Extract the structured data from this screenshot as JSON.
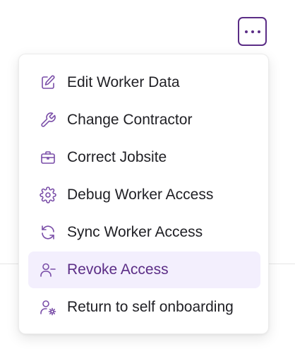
{
  "colors": {
    "accent": "#5b2d86",
    "icon": "#7a4ea8",
    "active_bg": "#f3effd",
    "text": "#1f1f24"
  },
  "more_button": {
    "icon": "ellipsis-icon"
  },
  "menu": {
    "items": [
      {
        "label": "Edit Worker Data",
        "icon": "edit-icon",
        "active": false
      },
      {
        "label": "Change Contractor",
        "icon": "wrench-icon",
        "active": false
      },
      {
        "label": "Correct Jobsite",
        "icon": "briefcase-icon",
        "active": false
      },
      {
        "label": "Debug Worker Access",
        "icon": "gear-icon",
        "active": false
      },
      {
        "label": "Sync Worker Access",
        "icon": "sync-icon",
        "active": false
      },
      {
        "label": "Revoke Access",
        "icon": "user-minus-icon",
        "active": true
      },
      {
        "label": "Return to self onboarding",
        "icon": "user-gear-icon",
        "active": false
      }
    ]
  }
}
